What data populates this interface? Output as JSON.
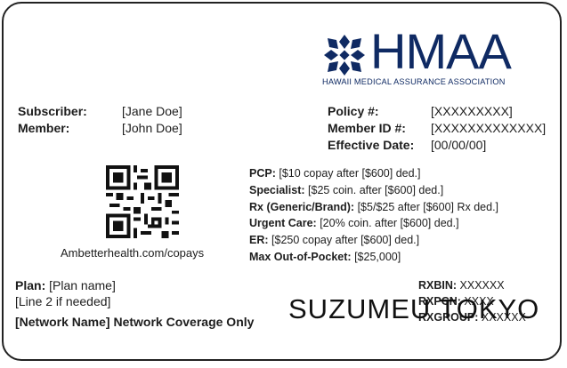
{
  "colors": {
    "brand": "#0f2a63",
    "text": "#1d1d1d",
    "border": "#222222"
  },
  "logo": {
    "wordmark": "HMAA",
    "tagline": "HAWAII MEDICAL ASSURANCE ASSOCIATION",
    "icon": "quilt-flower-icon"
  },
  "subscriber": {
    "label": "Subscriber:",
    "value": "[Jane Doe]"
  },
  "member": {
    "label": "Member:",
    "value": "[John Doe]"
  },
  "policy": {
    "label": "Policy #:",
    "value": "[XXXXXXXXX]"
  },
  "member_id": {
    "label": "Member ID #:",
    "value": "[XXXXXXXXXXXXX]"
  },
  "effective_date": {
    "label": "Effective Date:",
    "value": "[00/00/00]"
  },
  "qr": {
    "icon": "qr-code-icon",
    "url": "Ambetterhealth.com/copays"
  },
  "benefits": [
    {
      "label": "PCP:",
      "value": "[$10 copay after [$600] ded.]"
    },
    {
      "label": "Specialist:",
      "value": "[$25 coin. after [$600] ded.]"
    },
    {
      "label": "Rx (Generic/Brand):",
      "value": "[$5/$25 after [$600] Rx ded.]"
    },
    {
      "label": "Urgent Care:",
      "value": "[20% coin. after [$600] ded.]"
    },
    {
      "label": "ER:",
      "value": "[$250 copay after [$600] ded.]"
    },
    {
      "label": "Max Out-of-Pocket:",
      "value": "[$25,000]"
    }
  ],
  "plan": {
    "label": "Plan:",
    "value": "[Plan name]",
    "line2": "[Line 2 if needed]"
  },
  "network": {
    "name": "[Network Name]",
    "suffix": "Network Coverage Only"
  },
  "rx_ids": [
    {
      "label": "RXBIN:",
      "value": "XXXXXX"
    },
    {
      "label": "RXPCN:",
      "value": "XXXX"
    },
    {
      "label": "RXGROUP:",
      "value": "XXXXXX"
    }
  ],
  "watermark": "SUZUMEU TOKYO"
}
